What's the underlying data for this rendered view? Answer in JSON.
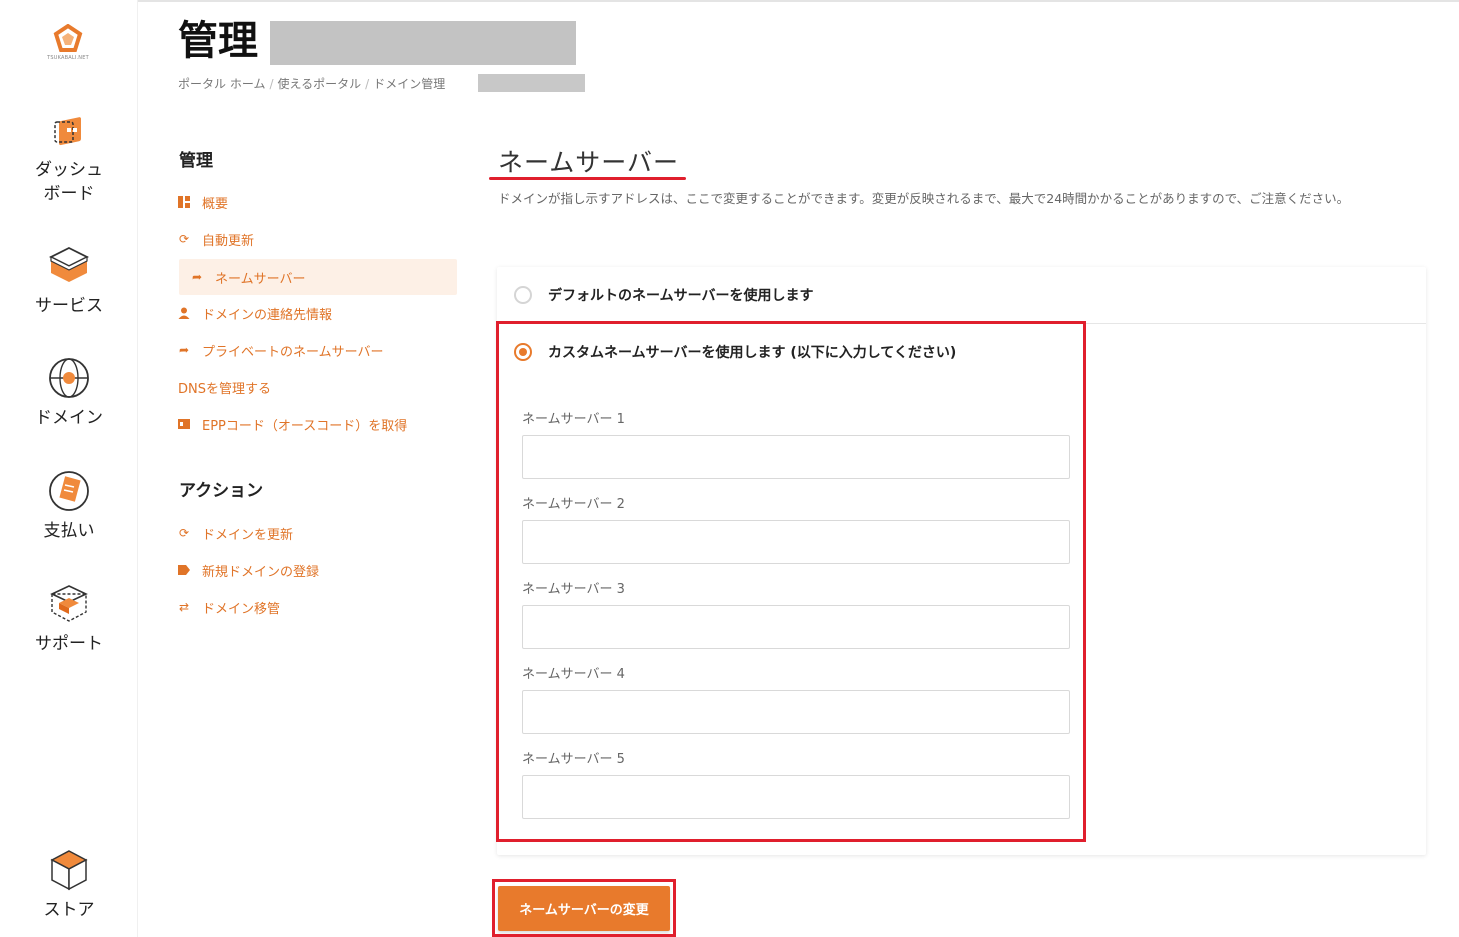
{
  "logo": {
    "text": "TSUKABALI.NET"
  },
  "rail": [
    {
      "key": "dashboard",
      "label": "ダッシュ\nボード",
      "icon": "dashboard-icon"
    },
    {
      "key": "services",
      "label": "サービス",
      "icon": "services-box-icon"
    },
    {
      "key": "domains",
      "label": "ドメイン",
      "icon": "globe-icon"
    },
    {
      "key": "billing",
      "label": "支払い",
      "icon": "billing-icon"
    },
    {
      "key": "support",
      "label": "サポート",
      "icon": "support-box-icon"
    },
    {
      "key": "store",
      "label": "ストア",
      "icon": "store-cube-icon"
    }
  ],
  "header": {
    "title": "管理",
    "breadcrumb": [
      "ポータル ホーム",
      "使えるポータル",
      "ドメイン管理"
    ]
  },
  "sidebar": {
    "manage_heading": "管理",
    "manage_items": [
      {
        "label": "概要",
        "icon": "overview-icon"
      },
      {
        "label": "自動更新",
        "icon": "sync-icon"
      },
      {
        "label": "ネームサーバー",
        "icon": "share-arrow-icon",
        "active": true
      },
      {
        "label": "ドメインの連絡先情報",
        "icon": "user-icon"
      },
      {
        "label": "プライベートのネームサーバー",
        "icon": "share-arrow-icon"
      },
      {
        "label": "DNSを管理する",
        "icon": ""
      },
      {
        "label": "EPPコード（オースコード）を取得",
        "icon": "card-icon"
      }
    ],
    "actions_heading": "アクション",
    "action_items": [
      {
        "label": "ドメインを更新",
        "icon": "sync-icon"
      },
      {
        "label": "新規ドメインの登録",
        "icon": "tag-icon"
      },
      {
        "label": "ドメイン移管",
        "icon": "transfer-icon"
      }
    ]
  },
  "main": {
    "title": "ネームサーバー",
    "description": "ドメインが指し示すアドレスは、ここで変更することができます。変更が反映されるまで、最大で24時間かかることがありますので、ご注意ください。",
    "option_default": "デフォルトのネームサーバーを使用します",
    "option_custom": "カスタムネームサーバーを使用します (以下に入力してください)",
    "selected_option": "custom",
    "nameservers": [
      {
        "label": "ネームサーバー 1",
        "value": ""
      },
      {
        "label": "ネームサーバー 2",
        "value": ""
      },
      {
        "label": "ネームサーバー 3",
        "value": ""
      },
      {
        "label": "ネームサーバー 4",
        "value": ""
      },
      {
        "label": "ネームサーバー 5",
        "value": ""
      }
    ],
    "submit_label": "ネームサーバーの変更"
  },
  "colors": {
    "accent": "#e87a2c",
    "link": "#e07428",
    "highlight": "#e01f2d",
    "active_bg": "#fdf0e6"
  }
}
